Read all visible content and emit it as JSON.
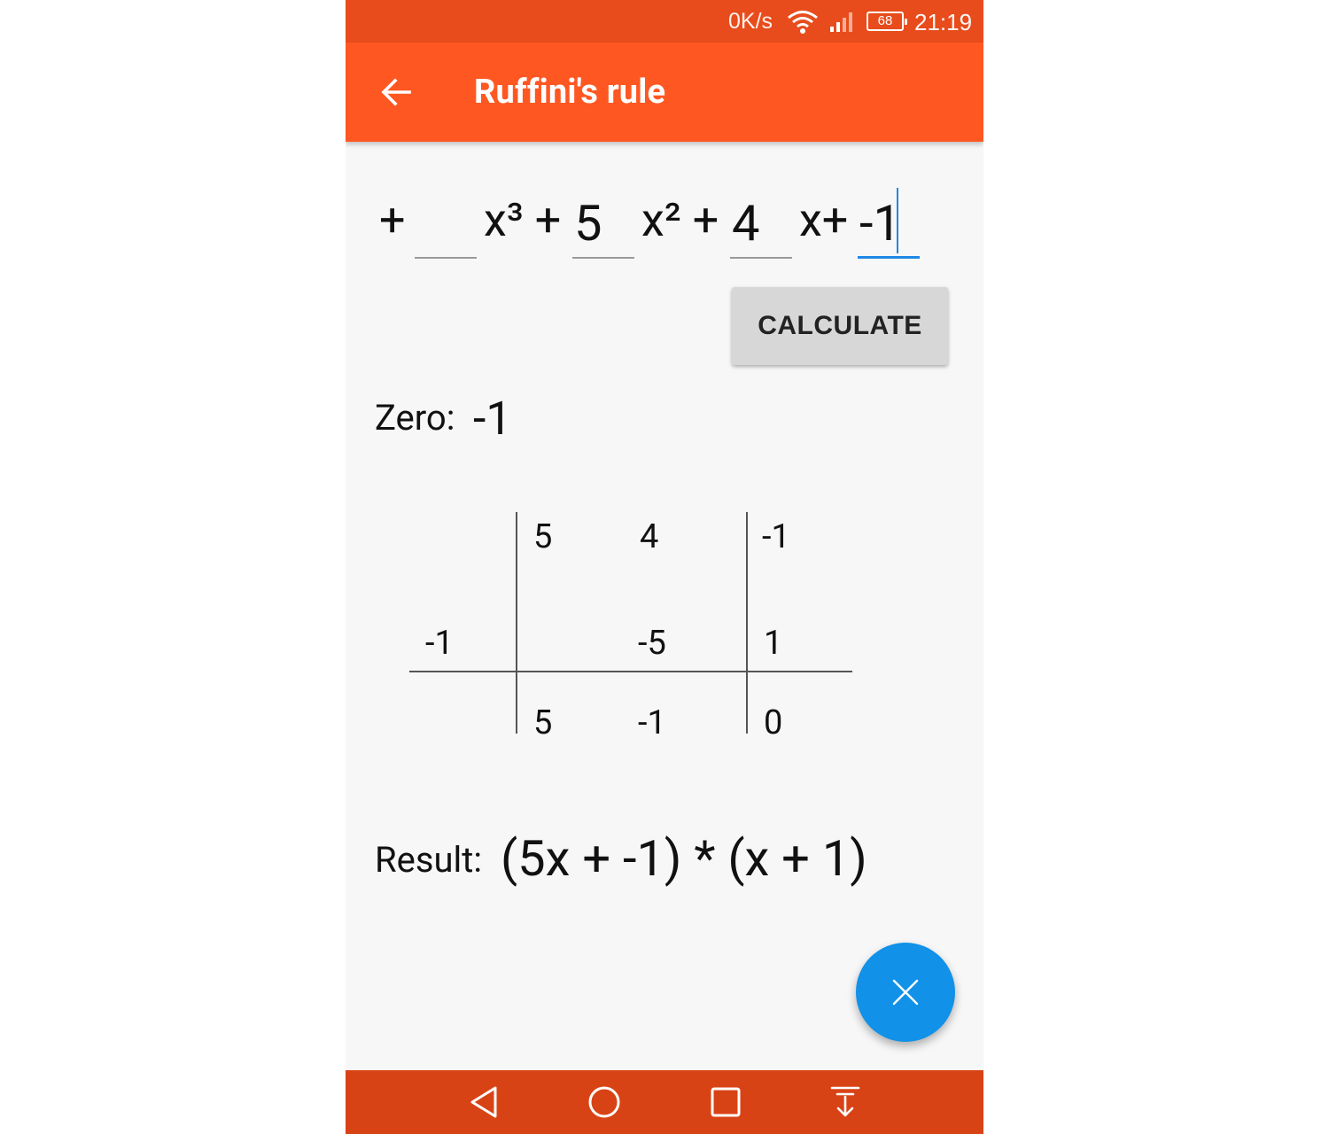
{
  "status_bar": {
    "net_speed": "0K/s",
    "battery": "68",
    "time": "21:19"
  },
  "toolbar": {
    "title": "Ruffini's rule"
  },
  "polynomial": {
    "leading_sign": "+",
    "coef_x3": "",
    "term_x3": "x³ +",
    "coef_x2": "5",
    "term_x2": "x² +",
    "coef_x1": "4",
    "term_x1": "x+",
    "coef_x0": "-1"
  },
  "calculate_label": "CALCULATE",
  "zero": {
    "label": "Zero:",
    "value": "-1"
  },
  "ruffini_table": {
    "top_row": [
      "5",
      "4",
      "-1"
    ],
    "divisor": "-1",
    "middle_row": [
      "",
      "-5",
      "1"
    ],
    "bottom_row": [
      "5",
      "-1",
      "0"
    ]
  },
  "result": {
    "label": "Result:",
    "value": "(5x + -1) * (x + 1)"
  },
  "colors": {
    "status_bar": "#e84c1c",
    "toolbar": "#ff5722",
    "nav_bar": "#d84315",
    "fab": "#1191e8",
    "active_underline": "#1e88e5"
  },
  "icons": {
    "back": "arrow-back-icon",
    "fab": "close-icon",
    "nav": [
      "back-triangle-icon",
      "home-circle-icon",
      "recents-square-icon",
      "notification-pull-icon"
    ]
  }
}
